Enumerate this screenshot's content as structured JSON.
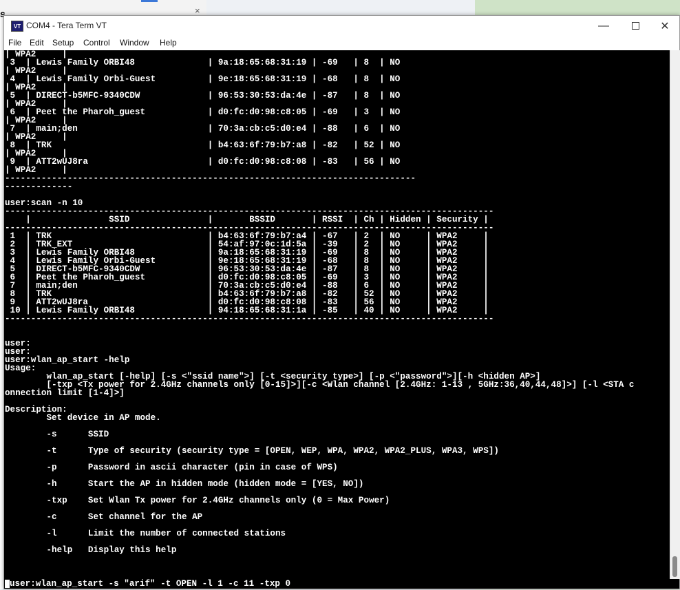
{
  "window": {
    "title": "COM4 - Tera Term VT",
    "app_icon_text": "VT"
  },
  "menu": [
    "File",
    "Edit",
    "Setup",
    "Control",
    "Window",
    "Help"
  ],
  "terminal": {
    "lines": [
      "| WPA2     |",
      " 3  | Lewis Family ORBI48              | 9a:18:65:68:31:19 | -69   | 8  | NO",
      "| WPA2     |",
      " 4  | Lewis Family Orbi-Guest          | 9e:18:65:68:31:19 | -68   | 8  | NO",
      "| WPA2     |",
      " 5  | DIRECT-b5MFC-9340CDW             | 96:53:30:53:da:4e | -87   | 8  | NO",
      "| WPA2     |",
      " 6  | Peet the Pharoh_guest            | d0:fc:d0:98:c8:05 | -69   | 3  | NO",
      "| WPA2     |",
      " 7  | main;den                         | 70:3a:cb:c5:d0:e4 | -88   | 6  | NO",
      "| WPA2     |",
      " 8  | TRK                              | b4:63:6f:79:b7:a8 | -82   | 52 | NO",
      "| WPA2     |",
      " 9  | ATT2wUJ8ra                       | d0:fc:d0:98:c8:08 | -83   | 56 | NO",
      "| WPA2     |",
      "-------------------------------------------------------------------------------",
      "-------------",
      "",
      "user:scan -n 10",
      "----------------------------------------------------------------------------------------------",
      "    |               SSID               |       BSSID       | RSSI  | Ch | Hidden | Security |",
      "----------------------------------------------------------------------------------------------",
      " 1  | TRK                              | b4:63:6f:79:b7:a4 | -67   | 2  | NO     | WPA2     |",
      " 2  | TRK_EXT                          | 54:af:97:0c:1d:5a | -39   | 2  | NO     | WPA2     |",
      " 3  | Lewis Family ORBI48              | 9a:18:65:68:31:19 | -69   | 8  | NO     | WPA2     |",
      " 4  | Lewis Family Orbi-Guest          | 9e:18:65:68:31:19 | -68   | 8  | NO     | WPA2     |",
      " 5  | DIRECT-b5MFC-9340CDW             | 96:53:30:53:da:4e | -87   | 8  | NO     | WPA2     |",
      " 6  | Peet the Pharoh_guest            | d0:fc:d0:98:c8:05 | -69   | 3  | NO     | WPA2     |",
      " 7  | main;den                         | 70:3a:cb:c5:d0:e4 | -88   | 6  | NO     | WPA2     |",
      " 8  | TRK                              | b4:63:6f:79:b7:a8 | -82   | 52 | NO     | WPA2     |",
      " 9  | ATT2wUJ8ra                       | d0:fc:d0:98:c8:08 | -83   | 56 | NO     | WPA2     |",
      " 10 | Lewis Family ORBI48              | 94:18:65:68:31:1a | -85   | 40 | NO     | WPA2     |",
      "----------------------------------------------------------------------------------------------",
      "",
      "",
      "user:",
      "user:",
      "user:wlan_ap_start -help",
      "Usage:",
      "        wlan_ap_start [-help] [-s <\"ssid name\">] [-t <security type>] [-p <\"password\">][-h <hidden AP>]",
      "        [-txp <Tx power for 2.4GHz channels only [0-15]>][-c <Wlan channel [2.4GHz: 1-13 , 5GHz:36,40,44,48]>] [-l <STA c",
      "onnection limit [1-4]>]",
      "",
      "Description:",
      "        Set device in AP mode.",
      "",
      "        -s      SSID",
      "",
      "        -t      Type of security (security type = [OPEN, WEP, WPA, WPA2, WPA2_PLUS, WPA3, WPS])",
      "",
      "        -p      Password in ascii character (pin in case of WPS)",
      "",
      "        -h      Start the AP in hidden mode (hidden mode = [YES, NO])",
      "",
      "        -txp    Set Wlan Tx power for 2.4GHz channels only (0 = Max Power)",
      "",
      "        -c      Set channel for the AP",
      "",
      "        -l      Limit the number of connected stations",
      "",
      "        -help   Display this help",
      "",
      ""
    ],
    "command_line": "user:wlan_ap_start -s \"arif\" -t OPEN -l 1 -c 11 -txp 0"
  },
  "background": {
    "left_window_letter": "s",
    "left_window_close": "×"
  }
}
